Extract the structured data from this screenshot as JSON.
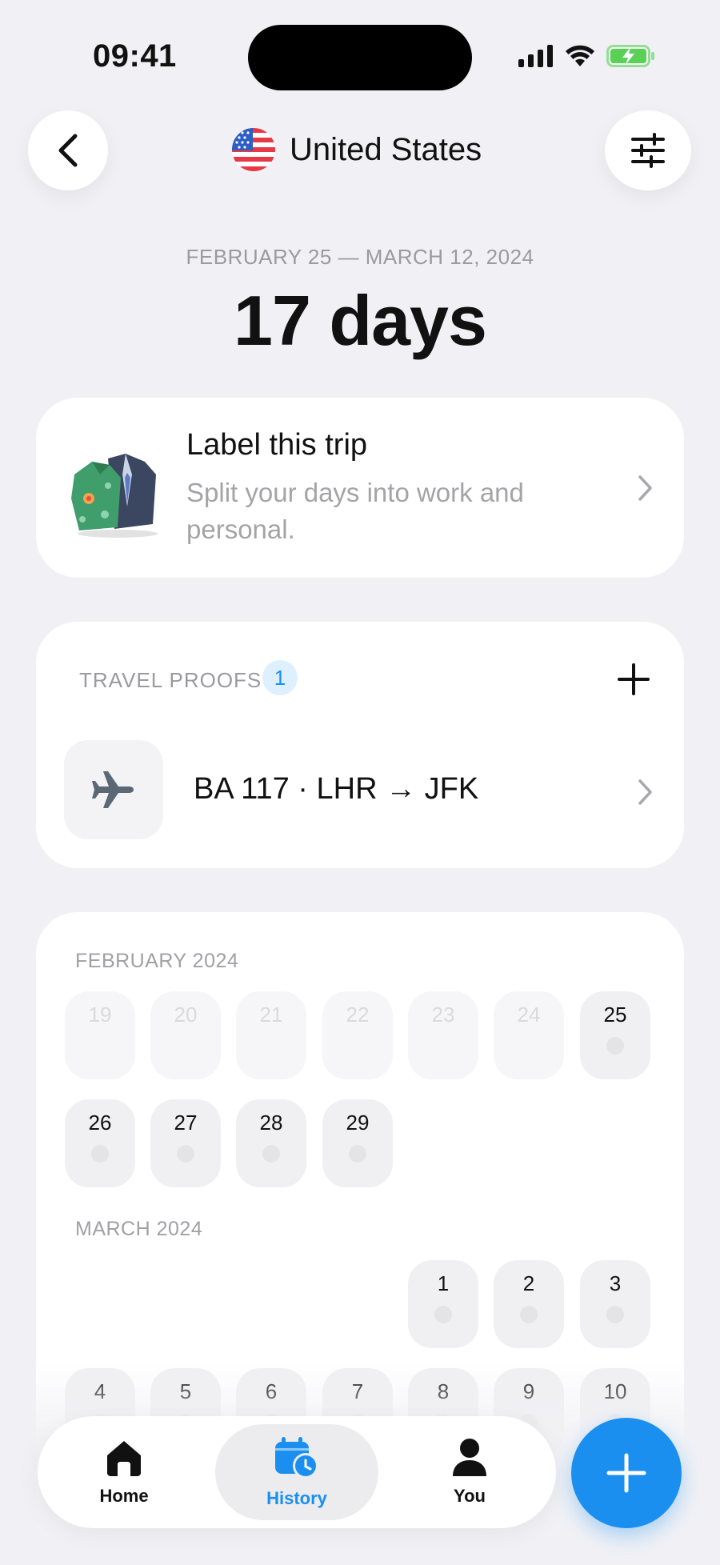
{
  "status_bar": {
    "time": "09:41"
  },
  "header": {
    "country": "United States"
  },
  "summary": {
    "date_range": "FEBRUARY 25 — MARCH 12, 2024",
    "duration": "17 days"
  },
  "label_card": {
    "title": "Label this trip",
    "subtitle": "Split your days into work and personal."
  },
  "proofs": {
    "title": "TRAVEL PROOFS",
    "count": "1",
    "items": [
      {
        "label": "BA 117 · LHR → JFK",
        "icon": "airplane-icon"
      }
    ]
  },
  "calendar": {
    "months": [
      {
        "label": "FEBRUARY 2024",
        "days": [
          {
            "num": "19",
            "in_trip": false
          },
          {
            "num": "20",
            "in_trip": false
          },
          {
            "num": "21",
            "in_trip": false
          },
          {
            "num": "22",
            "in_trip": false
          },
          {
            "num": "23",
            "in_trip": false
          },
          {
            "num": "24",
            "in_trip": false
          },
          {
            "num": "25",
            "in_trip": true
          },
          {
            "num": "26",
            "in_trip": true
          },
          {
            "num": "27",
            "in_trip": true
          },
          {
            "num": "28",
            "in_trip": true
          },
          {
            "num": "29",
            "in_trip": true
          }
        ]
      },
      {
        "label": "MARCH 2024",
        "days": [
          {
            "num": "1",
            "in_trip": true
          },
          {
            "num": "2",
            "in_trip": true
          },
          {
            "num": "3",
            "in_trip": true
          },
          {
            "num": "4",
            "in_trip": true
          },
          {
            "num": "5",
            "in_trip": true
          },
          {
            "num": "6",
            "in_trip": true
          },
          {
            "num": "7",
            "in_trip": true
          },
          {
            "num": "8",
            "in_trip": true
          },
          {
            "num": "9",
            "in_trip": true
          },
          {
            "num": "10",
            "in_trip": true
          }
        ]
      }
    ]
  },
  "tabbar": {
    "home": "Home",
    "history": "History",
    "you": "You",
    "active": "History"
  },
  "colors": {
    "accent": "#1a8ff0",
    "background": "#f1f1f5"
  }
}
